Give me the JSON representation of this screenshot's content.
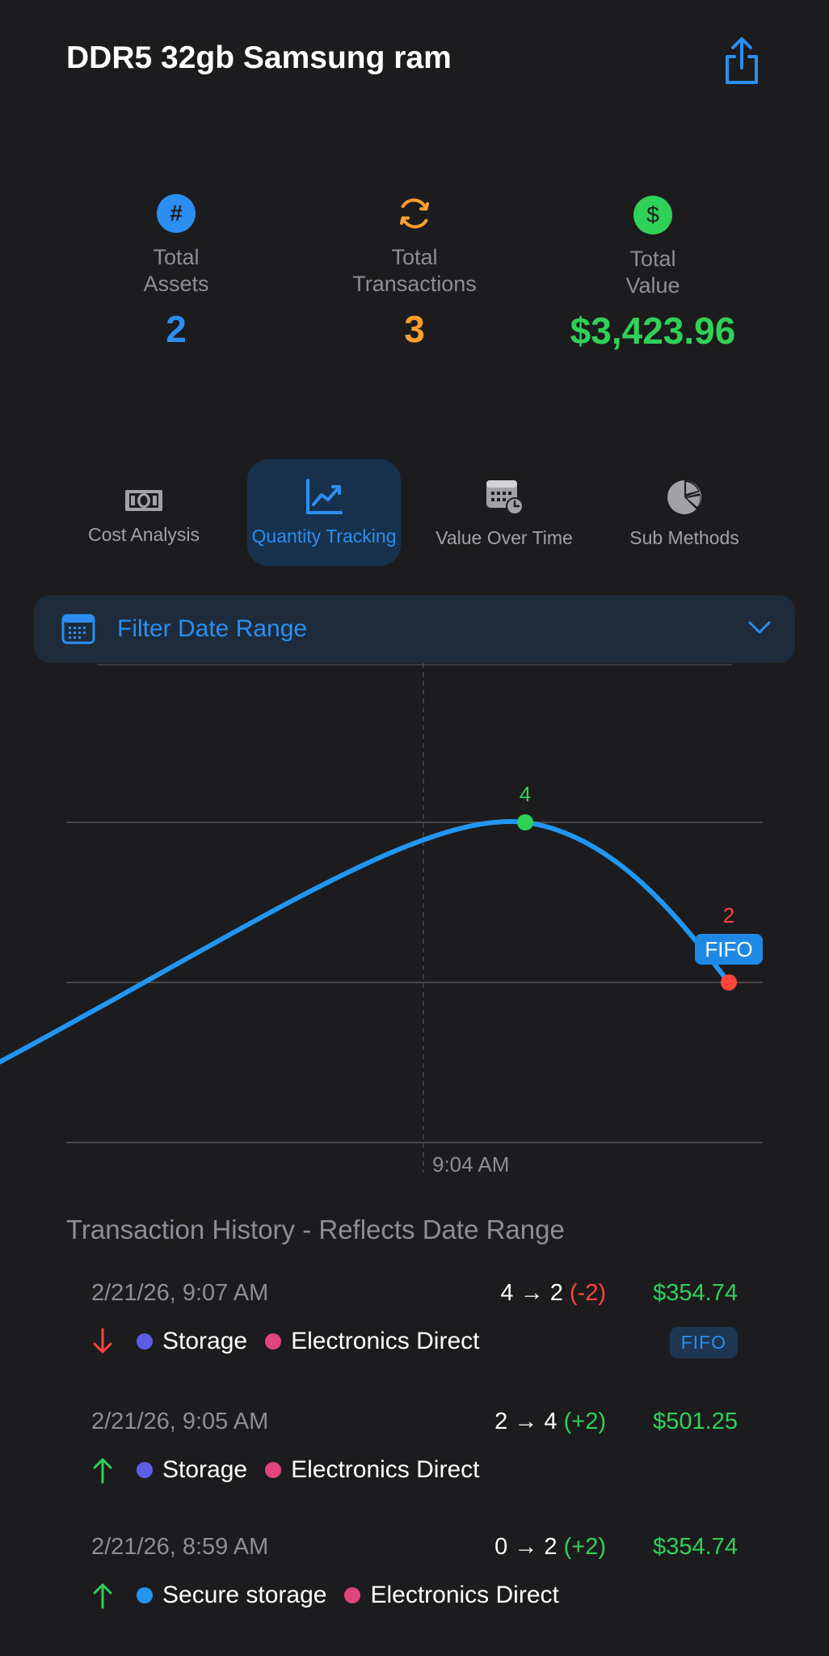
{
  "header": {
    "title": "DDR5 32gb Samsung ram"
  },
  "stats": [
    {
      "icon": "hash-icon",
      "glyph": "#",
      "label_line1": "Total",
      "label_line2": "Assets",
      "value": "2",
      "color": "#2c8ef0"
    },
    {
      "icon": "refresh-icon",
      "glyph": "",
      "label_line1": "Total",
      "label_line2": "Transactions",
      "value": "3",
      "color": "#ff9f2e"
    },
    {
      "icon": "dollar-icon",
      "glyph": "$",
      "label_line1": "Total",
      "label_line2": "Value",
      "value": "$3,423.96",
      "color": "#30d158"
    }
  ],
  "tabs": [
    {
      "label": "Cost Analysis",
      "icon": "banknote-icon",
      "active": false
    },
    {
      "label": "Quantity Tracking",
      "icon": "chart-line-icon",
      "active": true
    },
    {
      "label": "Value Over Time",
      "icon": "calendar-clock-icon",
      "active": false
    },
    {
      "label": "Sub Methods",
      "icon": "pie-chart-icon",
      "active": false
    }
  ],
  "filter": {
    "label": "Filter Date Range"
  },
  "chart_data": {
    "type": "line",
    "x": [
      "8:59 AM",
      "9:05 AM",
      "9:07 AM"
    ],
    "values": [
      2,
      4,
      2
    ],
    "point_labels": [
      "",
      "4",
      "2"
    ],
    "badge": "FIFO",
    "x_tick_label": "9:04 AM",
    "ylim": [
      0,
      5
    ],
    "grid": true,
    "colors": {
      "line": "#2196f3",
      "up": "#30d158",
      "down": "#ff453a"
    }
  },
  "history": {
    "title": "Transaction History - Reflects Date Range",
    "items": [
      {
        "date": "2/21/26, 9:07 AM",
        "from": "4",
        "to": "2",
        "delta": "(-2)",
        "direction": "down",
        "amount": "$354.74",
        "location": "Storage",
        "location_color": "#5e5ce6",
        "vendor": "Electronics Direct",
        "vendor_color": "#e0457b",
        "badge": "FIFO"
      },
      {
        "date": "2/21/26, 9:05 AM",
        "from": "2",
        "to": "4",
        "delta": "(+2)",
        "direction": "up",
        "amount": "$501.25",
        "location": "Storage",
        "location_color": "#5e5ce6",
        "vendor": "Electronics Direct",
        "vendor_color": "#e0457b",
        "badge": ""
      },
      {
        "date": "2/21/26, 8:59 AM",
        "from": "0",
        "to": "2",
        "delta": "(+2)",
        "direction": "up",
        "amount": "$354.74",
        "location": "Secure storage",
        "location_color": "#2196f3",
        "vendor": "Electronics Direct",
        "vendor_color": "#e0457b",
        "badge": ""
      }
    ]
  }
}
